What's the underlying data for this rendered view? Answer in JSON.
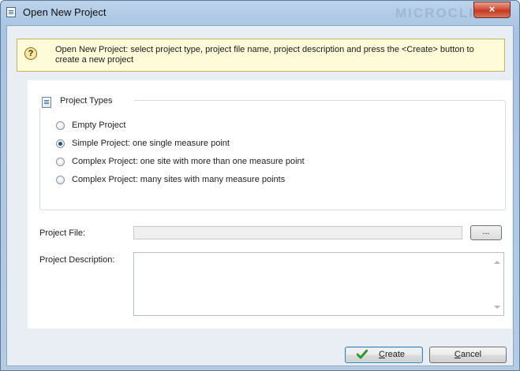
{
  "window": {
    "title": "Open New Project",
    "watermark": "MICROCLIMA",
    "close_glyph": "×"
  },
  "info": {
    "icon": "question-help-icon",
    "text": "Open New Project: select project type, project file name, project description and press the <Create> button to create a new project"
  },
  "project_types": {
    "title": "Project Types",
    "options": [
      {
        "label": "Empty Project",
        "checked": false
      },
      {
        "label": "Simple Project: one single measure point",
        "checked": true
      },
      {
        "label": "Complex Project: one site with more than one measure point",
        "checked": false
      },
      {
        "label": "Complex Project: many sites with many measure points",
        "checked": false
      }
    ]
  },
  "fields": {
    "project_file_label": "Project File:",
    "project_file_value": "",
    "browse_label": "...",
    "description_label": "Project Description:",
    "description_value": ""
  },
  "buttons": {
    "create_first": "C",
    "create_rest": "reate",
    "cancel_first": "C",
    "cancel_rest": "ancel"
  },
  "colors": {
    "accent_check": "#2e9a2e",
    "info_background": "#fefcd8",
    "radio_dot": "#1f4f93"
  }
}
